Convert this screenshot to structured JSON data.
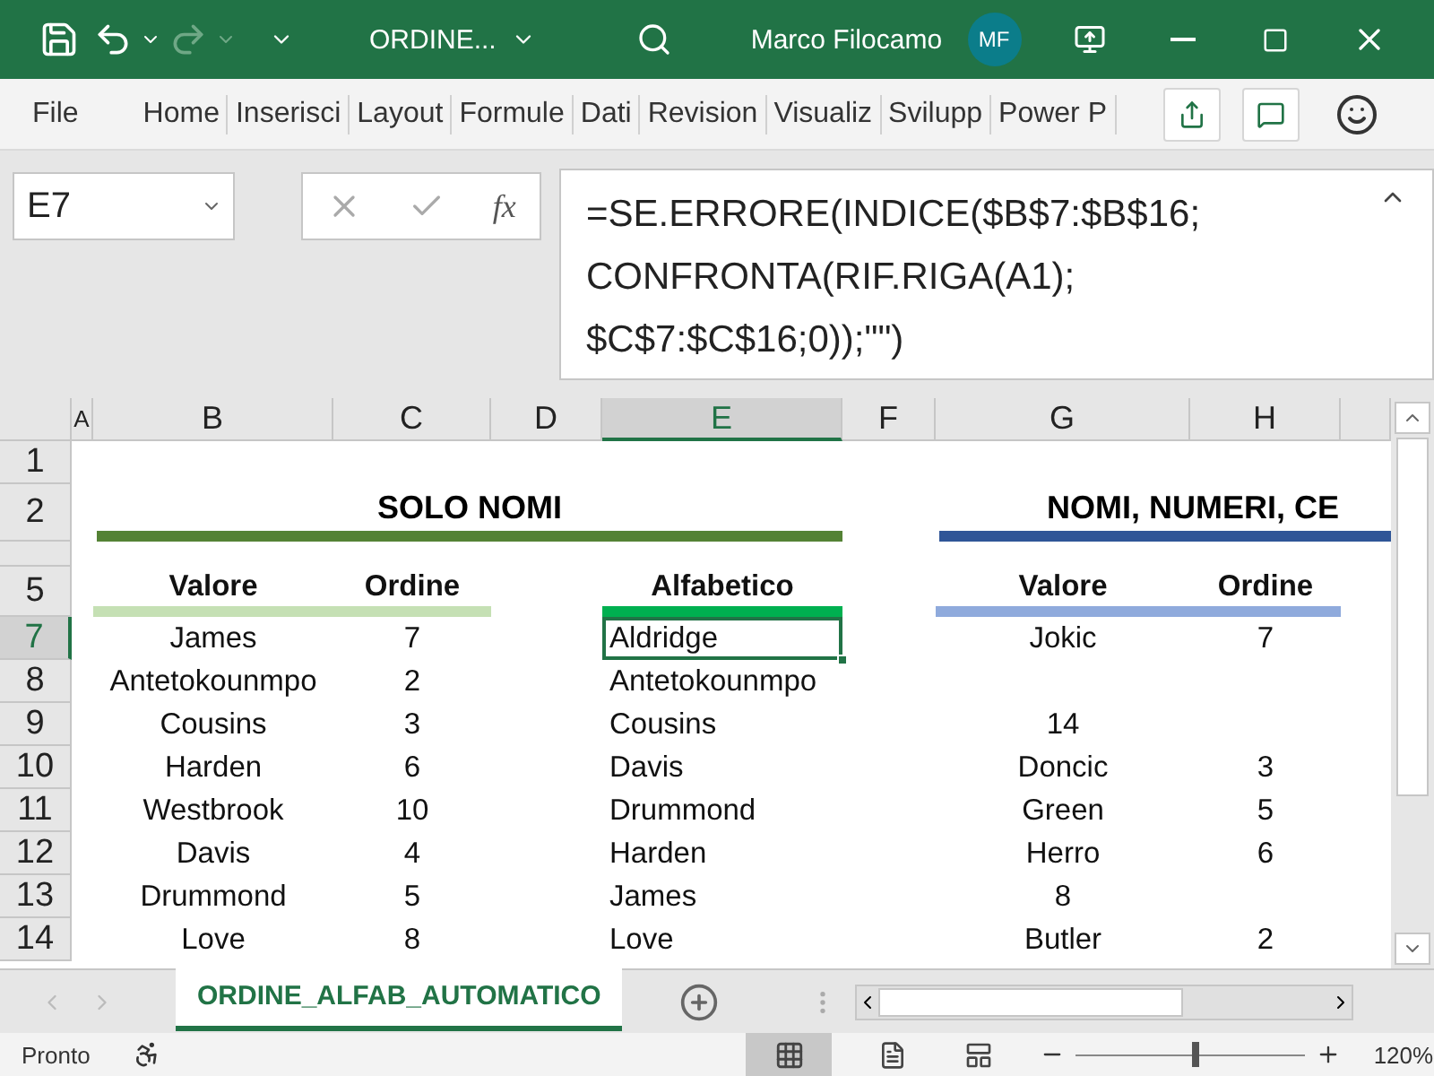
{
  "title_bar": {
    "quick_access": [
      {
        "kind": "save",
        "disabled": false
      },
      {
        "kind": "undo",
        "disabled": false
      },
      {
        "kind": "redo",
        "disabled": true
      }
    ],
    "file_name": "ORDINE...",
    "user_name": "Marco Filocamo",
    "avatar_initials": "MF"
  },
  "ribbon_tabs": [
    {
      "label": "File",
      "selected": false
    },
    {
      "label": "Home",
      "selected": false
    },
    {
      "label": "Inserisci",
      "selected": false
    },
    {
      "label": "Layout",
      "selected": false
    },
    {
      "label": "Formule",
      "selected": false
    },
    {
      "label": "Dati",
      "selected": false
    },
    {
      "label": "Revision",
      "selected": false
    },
    {
      "label": "Visualiz",
      "selected": false
    },
    {
      "label": "Svilupp",
      "selected": false
    },
    {
      "label": "Power P",
      "selected": false
    }
  ],
  "formula_bar": {
    "name_box": "E7",
    "function_label": "fx",
    "formula_lines": [
      "=SE.ERRORE(INDICE($B$7:$B$16;",
      "CONFRONTA(RIF.RIGA(A1);",
      "$C$7:$C$16;0));\"\")"
    ]
  },
  "sheet": {
    "columns": [
      {
        "label": "A",
        "selected": false
      },
      {
        "label": "B",
        "selected": false
      },
      {
        "label": "C",
        "selected": false
      },
      {
        "label": "D",
        "selected": false
      },
      {
        "label": "E",
        "selected": true
      },
      {
        "label": "F",
        "selected": false
      },
      {
        "label": "G",
        "selected": false
      },
      {
        "label": "H",
        "selected": false
      }
    ],
    "rows": [
      {
        "kind": "blank",
        "label": "1",
        "selected": false
      },
      {
        "kind": "title",
        "label": "2",
        "selected": false
      },
      {
        "kind": "collapsed",
        "selected": false
      },
      {
        "kind": "header",
        "label": "5",
        "selected": false
      },
      {
        "kind": "data",
        "label": "7",
        "selected": true
      },
      {
        "kind": "data",
        "label": "8",
        "selected": false
      },
      {
        "kind": "data",
        "label": "9",
        "selected": false
      },
      {
        "kind": "data",
        "label": "10",
        "selected": false
      },
      {
        "kind": "data",
        "label": "11",
        "selected": false
      },
      {
        "kind": "data",
        "label": "12",
        "selected": false
      },
      {
        "kind": "data",
        "label": "13",
        "selected": false
      },
      {
        "kind": "data",
        "label": "14",
        "selected": false
      }
    ]
  },
  "solo_nomi": {
    "title": "SOLO NOMI",
    "headers": [
      "Valore",
      "Ordine"
    ],
    "rows": [
      {
        "valore": "James",
        "ordine": "7"
      },
      {
        "valore": "Antetokounmpo",
        "ordine": "2"
      },
      {
        "valore": "Cousins",
        "ordine": "3"
      },
      {
        "valore": "Harden",
        "ordine": "6"
      },
      {
        "valore": "Westbrook",
        "ordine": "10"
      },
      {
        "valore": "Davis",
        "ordine": "4"
      },
      {
        "valore": "Drummond",
        "ordine": "5"
      },
      {
        "valore": "Love",
        "ordine": "8"
      }
    ]
  },
  "alfabetico": {
    "header": "Alfabetico",
    "items": [
      {
        "text": "Aldridge",
        "selected": true
      },
      {
        "text": "Antetokounmpo",
        "selected": false
      },
      {
        "text": "Cousins",
        "selected": false
      },
      {
        "text": "Davis",
        "selected": false
      },
      {
        "text": "Drummond",
        "selected": false
      },
      {
        "text": "Harden",
        "selected": false
      },
      {
        "text": "James",
        "selected": false
      },
      {
        "text": "Love",
        "selected": false
      }
    ]
  },
  "nomi_numeri": {
    "title": "NOMI, NUMERI, CE",
    "headers": [
      "Valore",
      "Ordine"
    ],
    "rows": [
      {
        "valore": "Jokic",
        "ordine": "7"
      },
      {},
      {
        "valore": "14"
      },
      {
        "valore": "Doncic",
        "ordine": "3"
      },
      {
        "valore": "Green",
        "ordine": "5"
      },
      {
        "valore": "Herro",
        "ordine": "6"
      },
      {
        "valore": "8"
      },
      {
        "valore": "Butler",
        "ordine": "2"
      }
    ]
  },
  "sheet_tabs": [
    {
      "label": "ORDINE_ALFAB_AUTOMATICO",
      "selected": true
    }
  ],
  "status_bar": {
    "status": "Pronto",
    "views": [
      {
        "kind": "normal",
        "selected": true
      },
      {
        "kind": "page_layout",
        "selected": false
      },
      {
        "kind": "page_break",
        "selected": false
      }
    ],
    "zoom": {
      "level": 0.52,
      "reading": "120%"
    }
  }
}
